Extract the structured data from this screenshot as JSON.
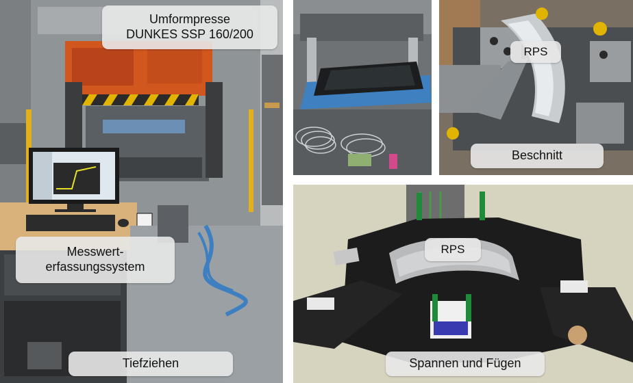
{
  "panels": {
    "press": {
      "title_line1": "Umformpresse",
      "title_line2": "DUNKES SSP 160/200",
      "measure_line1": "Messwert-",
      "measure_line2": "erfassungssystem",
      "deep_drawing": "Tiefziehen"
    },
    "die": {},
    "trim": {
      "rps": "RPS",
      "caption": "Beschnitt"
    },
    "fixture": {
      "rps": "RPS",
      "caption": "Spannen und Fügen"
    }
  },
  "colors": {
    "label_bg": "#e8e8e8",
    "press_orange": "#d2571e",
    "floor_blue": "#3d7fc1",
    "monitor_screen": "#dfe8ee",
    "fixture_black": "#1c1c1c",
    "clamp_green": "#1f8a3a"
  }
}
